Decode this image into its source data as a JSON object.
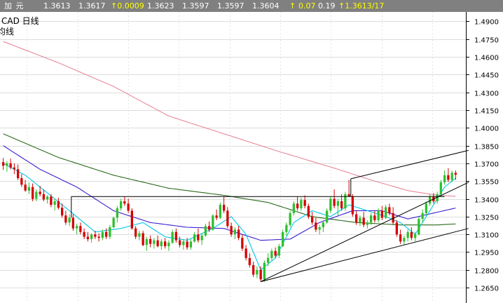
{
  "quote_bar": {
    "symbol": "加 元",
    "open": "1.3613",
    "prev_close": "1.3617",
    "change": "↑0.0009",
    "high": "1.3623",
    "low": "1.3597",
    "last": "1.3597",
    "close": "1.3604",
    "up_arrow": "↑",
    "change_pct": "0.07",
    "volume": "0.19",
    "bid": "↑1.3613/17"
  },
  "chart_header": {
    "title": "CAD  日线",
    "subtitle": "均线"
  },
  "colors": {
    "background": "#ffffff",
    "up_candle": "#2fbf2f",
    "down_candle": "#d40000",
    "ma_fast": "#00c8e6",
    "ma_mid": "#3a1fd0",
    "ma_slow": "#2a6a1a",
    "ma_long": "#e8889a",
    "trendline": "#000000"
  },
  "chart_data": {
    "type": "candlestick",
    "timeframe": "日线",
    "ylim": [
      1.252,
      1.498
    ],
    "y_ticks": [
      "1.4900",
      "1.4750",
      "1.4600",
      "1.4450",
      "1.4300",
      "1.4150",
      "1.4000",
      "1.3850",
      "1.3700",
      "1.3550",
      "1.3400",
      "1.3250",
      "1.3100",
      "1.2950",
      "1.2800",
      "1.2650"
    ],
    "candles": [
      [
        1.371,
        1.3745,
        1.3645,
        1.368
      ],
      [
        1.368,
        1.372,
        1.363,
        1.37
      ],
      [
        1.37,
        1.374,
        1.365,
        1.3665
      ],
      [
        1.3665,
        1.37,
        1.361,
        1.365
      ],
      [
        1.365,
        1.369,
        1.356,
        1.3575
      ],
      [
        1.3575,
        1.361,
        1.35,
        1.352
      ],
      [
        1.352,
        1.356,
        1.346,
        1.347
      ],
      [
        1.347,
        1.354,
        1.344,
        1.35
      ],
      [
        1.35,
        1.353,
        1.338,
        1.34
      ],
      [
        1.34,
        1.348,
        1.338,
        1.346
      ],
      [
        1.346,
        1.351,
        1.342,
        1.344
      ],
      [
        1.344,
        1.348,
        1.338,
        1.3395
      ],
      [
        1.3395,
        1.343,
        1.336,
        1.342
      ],
      [
        1.342,
        1.344,
        1.333,
        1.335
      ],
      [
        1.335,
        1.34,
        1.33,
        1.338
      ],
      [
        1.338,
        1.341,
        1.331,
        1.3325
      ],
      [
        1.3325,
        1.336,
        1.324,
        1.326
      ],
      [
        1.326,
        1.33,
        1.318,
        1.32
      ],
      [
        1.32,
        1.327,
        1.317,
        1.324
      ],
      [
        1.324,
        1.327,
        1.313,
        1.315
      ],
      [
        1.315,
        1.319,
        1.31,
        1.317
      ],
      [
        1.317,
        1.32,
        1.31,
        1.312
      ],
      [
        1.312,
        1.315,
        1.306,
        1.308
      ],
      [
        1.308,
        1.312,
        1.304,
        1.306
      ],
      [
        1.306,
        1.311,
        1.303,
        1.31
      ],
      [
        1.31,
        1.313,
        1.306,
        1.308
      ],
      [
        1.308,
        1.311,
        1.304,
        1.307
      ],
      [
        1.307,
        1.314,
        1.305,
        1.312
      ],
      [
        1.312,
        1.315,
        1.306,
        1.308
      ],
      [
        1.308,
        1.318,
        1.306,
        1.316
      ],
      [
        1.316,
        1.325,
        1.315,
        1.324
      ],
      [
        1.324,
        1.334,
        1.32,
        1.332
      ],
      [
        1.332,
        1.34,
        1.33,
        1.338
      ],
      [
        1.338,
        1.342,
        1.334,
        1.336
      ],
      [
        1.336,
        1.34,
        1.328,
        1.33
      ],
      [
        1.33,
        1.332,
        1.314,
        1.315
      ],
      [
        1.315,
        1.317,
        1.306,
        1.308
      ],
      [
        1.308,
        1.313,
        1.305,
        1.311
      ],
      [
        1.311,
        1.313,
        1.3,
        1.301
      ],
      [
        1.301,
        1.308,
        1.296,
        1.306
      ],
      [
        1.306,
        1.309,
        1.299,
        1.302
      ],
      [
        1.302,
        1.307,
        1.298,
        1.305
      ],
      [
        1.305,
        1.309,
        1.299,
        1.3
      ],
      [
        1.3,
        1.306,
        1.297,
        1.304
      ],
      [
        1.304,
        1.307,
        1.298,
        1.3
      ],
      [
        1.3,
        1.305,
        1.296,
        1.303
      ],
      [
        1.303,
        1.314,
        1.302,
        1.312
      ],
      [
        1.312,
        1.315,
        1.303,
        1.305
      ],
      [
        1.305,
        1.308,
        1.299,
        1.301
      ],
      [
        1.301,
        1.306,
        1.297,
        1.304
      ],
      [
        1.304,
        1.307,
        1.297,
        1.299
      ],
      [
        1.299,
        1.306,
        1.297,
        1.304
      ],
      [
        1.304,
        1.312,
        1.303,
        1.31
      ],
      [
        1.31,
        1.315,
        1.303,
        1.305
      ],
      [
        1.305,
        1.311,
        1.301,
        1.309
      ],
      [
        1.309,
        1.319,
        1.308,
        1.317
      ],
      [
        1.317,
        1.321,
        1.312,
        1.314
      ],
      [
        1.314,
        1.327,
        1.313,
        1.326
      ],
      [
        1.326,
        1.331,
        1.322,
        1.324
      ],
      [
        1.324,
        1.337,
        1.323,
        1.335
      ],
      [
        1.335,
        1.342,
        1.328,
        1.33
      ],
      [
        1.33,
        1.333,
        1.315,
        1.317
      ],
      [
        1.317,
        1.32,
        1.308,
        1.31
      ],
      [
        1.31,
        1.316,
        1.306,
        1.314
      ],
      [
        1.314,
        1.317,
        1.305,
        1.307
      ],
      [
        1.307,
        1.31,
        1.296,
        1.298
      ],
      [
        1.298,
        1.301,
        1.288,
        1.29
      ],
      [
        1.29,
        1.294,
        1.282,
        1.284
      ],
      [
        1.284,
        1.287,
        1.274,
        1.276
      ],
      [
        1.276,
        1.283,
        1.273,
        1.28
      ],
      [
        1.28,
        1.283,
        1.27,
        1.272
      ],
      [
        1.272,
        1.288,
        1.27,
        1.286
      ],
      [
        1.286,
        1.294,
        1.283,
        1.29
      ],
      [
        1.29,
        1.298,
        1.288,
        1.296
      ],
      [
        1.296,
        1.299,
        1.29,
        1.292
      ],
      [
        1.292,
        1.302,
        1.29,
        1.3
      ],
      [
        1.3,
        1.314,
        1.299,
        1.312
      ],
      [
        1.312,
        1.32,
        1.309,
        1.318
      ],
      [
        1.318,
        1.33,
        1.316,
        1.328
      ],
      [
        1.328,
        1.338,
        1.326,
        1.336
      ],
      [
        1.336,
        1.342,
        1.33,
        1.332
      ],
      [
        1.332,
        1.341,
        1.33,
        1.339
      ],
      [
        1.339,
        1.343,
        1.332,
        1.334
      ],
      [
        1.334,
        1.336,
        1.323,
        1.325
      ],
      [
        1.325,
        1.329,
        1.318,
        1.32
      ],
      [
        1.32,
        1.324,
        1.312,
        1.314
      ],
      [
        1.314,
        1.318,
        1.31,
        1.316
      ],
      [
        1.316,
        1.322,
        1.312,
        1.32
      ],
      [
        1.32,
        1.332,
        1.319,
        1.33
      ],
      [
        1.33,
        1.342,
        1.328,
        1.34
      ],
      [
        1.34,
        1.348,
        1.332,
        1.334
      ],
      [
        1.334,
        1.34,
        1.326,
        1.338
      ],
      [
        1.338,
        1.344,
        1.33,
        1.332
      ],
      [
        1.332,
        1.346,
        1.33,
        1.344
      ],
      [
        1.344,
        1.356,
        1.342,
        1.342
      ],
      [
        1.342,
        1.344,
        1.325,
        1.327
      ],
      [
        1.327,
        1.33,
        1.318,
        1.32
      ],
      [
        1.32,
        1.326,
        1.317,
        1.324
      ],
      [
        1.324,
        1.329,
        1.316,
        1.318
      ],
      [
        1.318,
        1.322,
        1.315,
        1.32
      ],
      [
        1.32,
        1.328,
        1.318,
        1.326
      ],
      [
        1.326,
        1.33,
        1.32,
        1.322
      ],
      [
        1.322,
        1.332,
        1.32,
        1.33
      ],
      [
        1.33,
        1.334,
        1.322,
        1.324
      ],
      [
        1.324,
        1.335,
        1.323,
        1.333
      ],
      [
        1.333,
        1.336,
        1.326,
        1.328
      ],
      [
        1.328,
        1.333,
        1.318,
        1.32
      ],
      [
        1.32,
        1.322,
        1.308,
        1.31
      ],
      [
        1.31,
        1.314,
        1.302,
        1.304
      ],
      [
        1.304,
        1.309,
        1.301,
        1.307
      ],
      [
        1.307,
        1.314,
        1.304,
        1.312
      ],
      [
        1.312,
        1.316,
        1.305,
        1.307
      ],
      [
        1.307,
        1.312,
        1.304,
        1.31
      ],
      [
        1.31,
        1.325,
        1.309,
        1.323
      ],
      [
        1.323,
        1.331,
        1.32,
        1.328
      ],
      [
        1.328,
        1.338,
        1.326,
        1.336
      ],
      [
        1.336,
        1.344,
        1.334,
        1.342
      ],
      [
        1.342,
        1.345,
        1.336,
        1.338
      ],
      [
        1.338,
        1.346,
        1.336,
        1.344
      ],
      [
        1.344,
        1.356,
        1.342,
        1.354
      ],
      [
        1.354,
        1.364,
        1.352,
        1.36
      ],
      [
        1.36,
        1.366,
        1.354,
        1.356
      ],
      [
        1.356,
        1.364,
        1.354,
        1.362
      ],
      [
        1.362,
        1.364,
        1.356,
        1.3604
      ]
    ],
    "ma_fast": [
      [
        0,
        1.37
      ],
      [
        6,
        1.36
      ],
      [
        12,
        1.345
      ],
      [
        18,
        1.33
      ],
      [
        25,
        1.312
      ],
      [
        32,
        1.315
      ],
      [
        38,
        1.32
      ],
      [
        44,
        1.308
      ],
      [
        50,
        1.305
      ],
      [
        57,
        1.315
      ],
      [
        62,
        1.325
      ],
      [
        66,
        1.31
      ],
      [
        70,
        1.28
      ],
      [
        74,
        1.29
      ],
      [
        79,
        1.32
      ],
      [
        84,
        1.33
      ],
      [
        89,
        1.325
      ],
      [
        94,
        1.335
      ],
      [
        99,
        1.33
      ],
      [
        104,
        1.325
      ],
      [
        108,
        1.32
      ],
      [
        112,
        1.31
      ],
      [
        116,
        1.33
      ],
      [
        120,
        1.35
      ],
      [
        124,
        1.36
      ]
    ],
    "ma_mid": [
      [
        0,
        1.385
      ],
      [
        10,
        1.365
      ],
      [
        20,
        1.35
      ],
      [
        30,
        1.33
      ],
      [
        40,
        1.32
      ],
      [
        50,
        1.316
      ],
      [
        60,
        1.315
      ],
      [
        70,
        1.305
      ],
      [
        78,
        1.306
      ],
      [
        86,
        1.32
      ],
      [
        95,
        1.33
      ],
      [
        103,
        1.33
      ],
      [
        110,
        1.323
      ],
      [
        117,
        1.328
      ],
      [
        124,
        1.333
      ]
    ],
    "ma_slow": [
      [
        0,
        1.395
      ],
      [
        15,
        1.375
      ],
      [
        30,
        1.36
      ],
      [
        45,
        1.349
      ],
      [
        60,
        1.343
      ],
      [
        72,
        1.337
      ],
      [
        84,
        1.325
      ],
      [
        96,
        1.32
      ],
      [
        108,
        1.318
      ],
      [
        118,
        1.318
      ],
      [
        124,
        1.319
      ]
    ],
    "ma_long": [
      [
        0,
        1.473
      ],
      [
        15,
        1.455
      ],
      [
        30,
        1.435
      ],
      [
        45,
        1.41
      ],
      [
        60,
        1.395
      ],
      [
        75,
        1.38
      ],
      [
        90,
        1.366
      ],
      [
        100,
        1.356
      ],
      [
        110,
        1.347
      ],
      [
        118,
        1.343
      ],
      [
        124,
        1.342
      ]
    ]
  }
}
